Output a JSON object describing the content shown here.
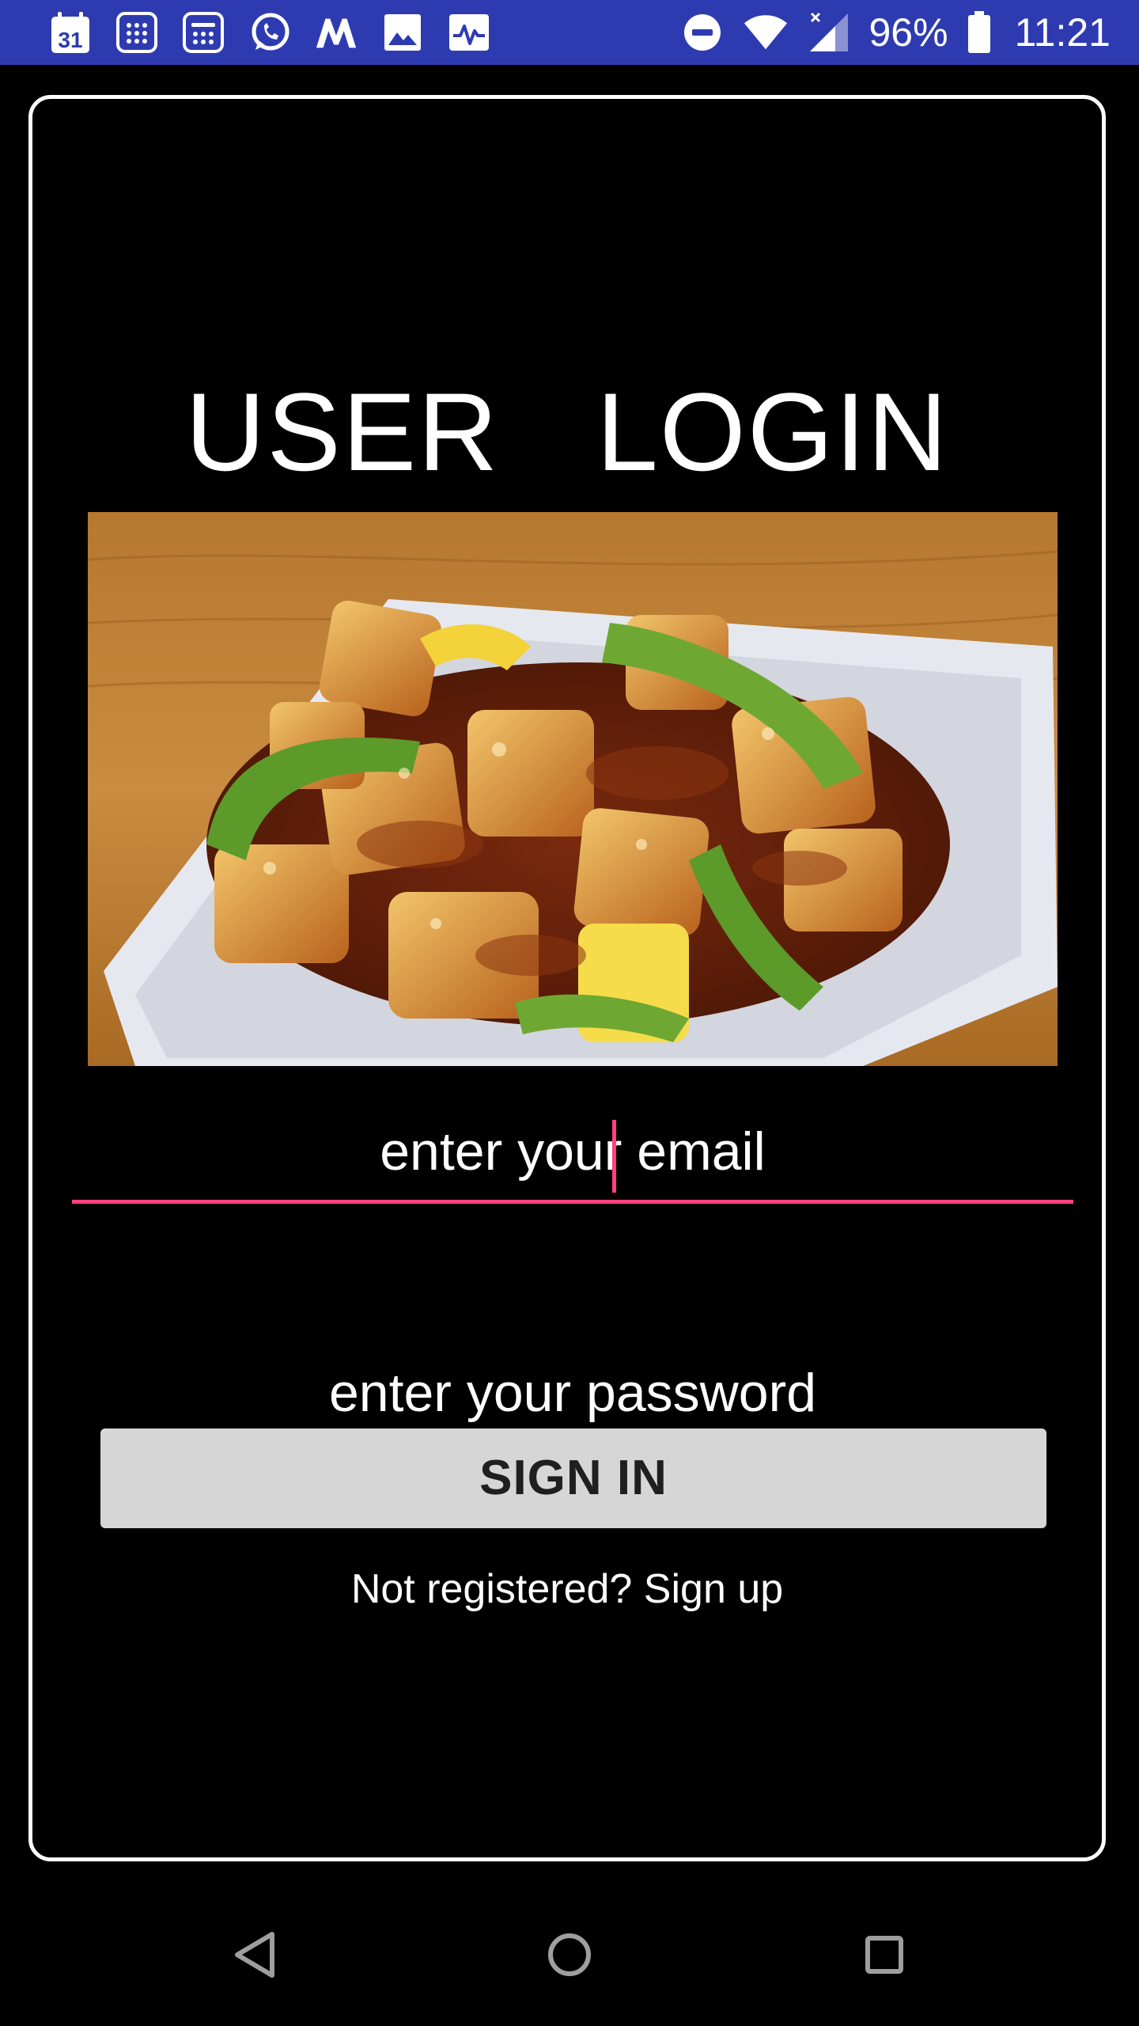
{
  "status_bar": {
    "battery_percent": "96%",
    "time": "11:21",
    "calendar_day": "31",
    "icons": [
      "calendar-icon",
      "calculator-icon",
      "calculator-icon",
      "whatsapp-icon",
      "myntra-icon",
      "gallery-icon",
      "activity-icon",
      "do-not-disturb-icon",
      "wifi-icon",
      "signal-icon",
      "battery-icon"
    ]
  },
  "login": {
    "title": "USER   LOGIN",
    "image_subject": "food-photo-chilli-paneer",
    "email": {
      "placeholder": "enter your email"
    },
    "password": {
      "placeholder": "enter your password"
    },
    "sign_in_label": "SIGN IN",
    "signup_link": "Not registered? Sign up"
  },
  "colors": {
    "status_bar": "#2e3bb0",
    "accent": "#ff4081",
    "background": "#000000",
    "button": "#d6d6d6"
  },
  "nav_bar": {
    "icons": [
      "back-icon",
      "home-icon",
      "recents-icon"
    ]
  }
}
